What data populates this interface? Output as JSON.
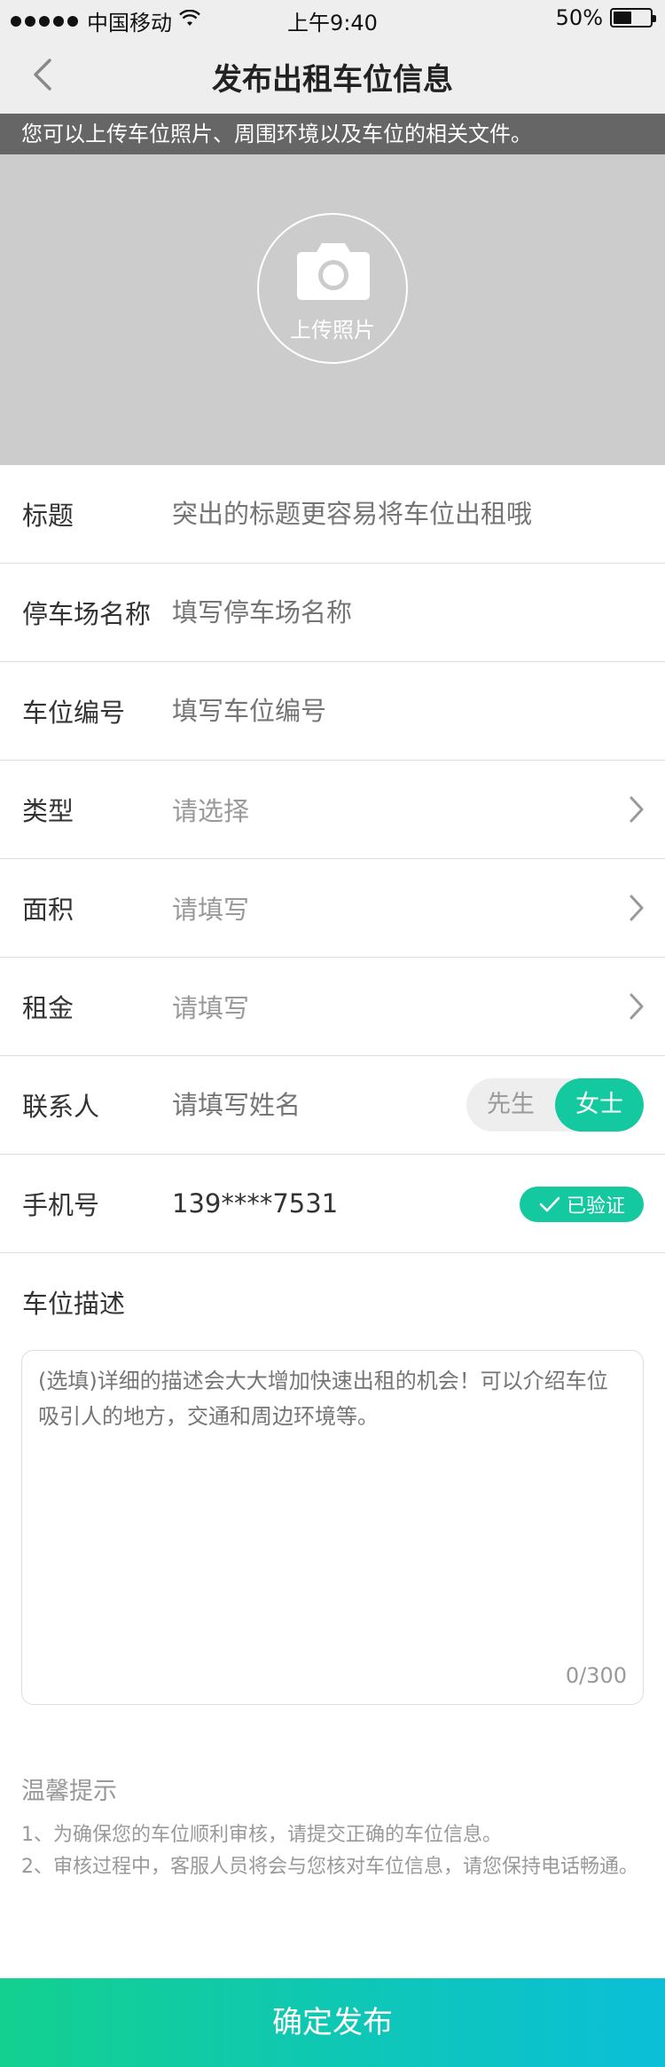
{
  "status_bar": {
    "carrier": "中国移动",
    "time": "上午9:40",
    "battery": "50%",
    "battery_level": 0.5
  },
  "nav": {
    "title": "发布出租车位信息"
  },
  "upload": {
    "tip": "您可以上传车位照片、周围环境以及车位的相关文件。",
    "label": "上传照片"
  },
  "form": {
    "title": {
      "label": "标题",
      "placeholder": "突出的标题更容易将车位出租哦"
    },
    "parking_name": {
      "label": "停车场名称",
      "placeholder": "填写停车场名称"
    },
    "space_number": {
      "label": "车位编号",
      "placeholder": "填写车位编号"
    },
    "type": {
      "label": "类型",
      "placeholder": "请选择"
    },
    "area": {
      "label": "面积",
      "placeholder": "请填写"
    },
    "rent": {
      "label": "租金",
      "placeholder": "请填写"
    },
    "contact": {
      "label": "联系人",
      "placeholder": "请填写姓名",
      "gender_options": [
        "先生",
        "女士"
      ],
      "gender_selected": "女士"
    },
    "phone": {
      "label": "手机号",
      "value": "139****7531",
      "verified_label": "已验证"
    }
  },
  "description": {
    "title": "车位描述",
    "placeholder": "(选填)详细的描述会大大增加快速出租的机会！可以介绍车位吸引人的地方，交通和周边环境等。",
    "counter": "0/300"
  },
  "notice": {
    "title": "温馨提示",
    "items": [
      "1、为确保您的车位顺利审核，请提交正确的车位信息。",
      "2、审核过程中，客服人员将会与您核对车位信息，请您保持电话畅通。"
    ]
  },
  "submit_label": "确定发布",
  "colors": {
    "accent": "#14c9a0",
    "gradient_start": "#13d08f",
    "gradient_end": "#0bbfd8"
  }
}
